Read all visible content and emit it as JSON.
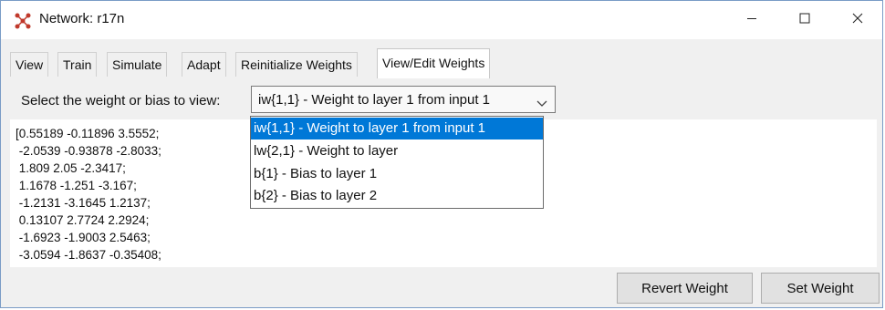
{
  "window": {
    "title": "Network: r17n"
  },
  "tabs": [
    {
      "label": "View",
      "active": false
    },
    {
      "label": "Train",
      "active": false
    },
    {
      "label": "Simulate",
      "active": false
    },
    {
      "label": "Adapt",
      "active": false
    },
    {
      "label": "Reinitialize Weights",
      "active": false
    },
    {
      "label": "View/Edit Weights",
      "active": true
    }
  ],
  "weights": {
    "select_label": "Select the weight or bias to view:",
    "selected_value": "iw{1,1} - Weight to layer 1 from input 1",
    "options": [
      {
        "label": "iw{1,1} - Weight to layer 1 from input 1",
        "highlighted": true
      },
      {
        "label": "lw{2,1} - Weight to layer",
        "highlighted": false
      },
      {
        "label": "b{1} - Bias to layer 1",
        "highlighted": false
      },
      {
        "label": "b{2} - Bias to layer 2",
        "highlighted": false
      }
    ],
    "matrix_lines": [
      "[0.55189 -0.11896 3.5552;",
      " -2.0539 -0.93878 -2.8033;",
      " 1.809 2.05 -2.3417;",
      " 1.1678 -1.251 -3.167;",
      " -1.2131 -3.1645 1.2137;",
      " 0.13107 2.7724 2.2924;",
      " -1.6923 -1.9003 2.5463;",
      " -3.0594 -1.8637 -0.35408;"
    ]
  },
  "buttons": {
    "revert": "Revert Weight",
    "set": "Set Weight"
  },
  "colors": {
    "selection": "#0078d7",
    "window_border": "#7a9cc6"
  },
  "icons": {
    "app": "network-icon",
    "minimize": "minimize-icon",
    "maximize": "maximize-icon",
    "close": "close-icon",
    "dropdown": "chevron-down-icon"
  }
}
